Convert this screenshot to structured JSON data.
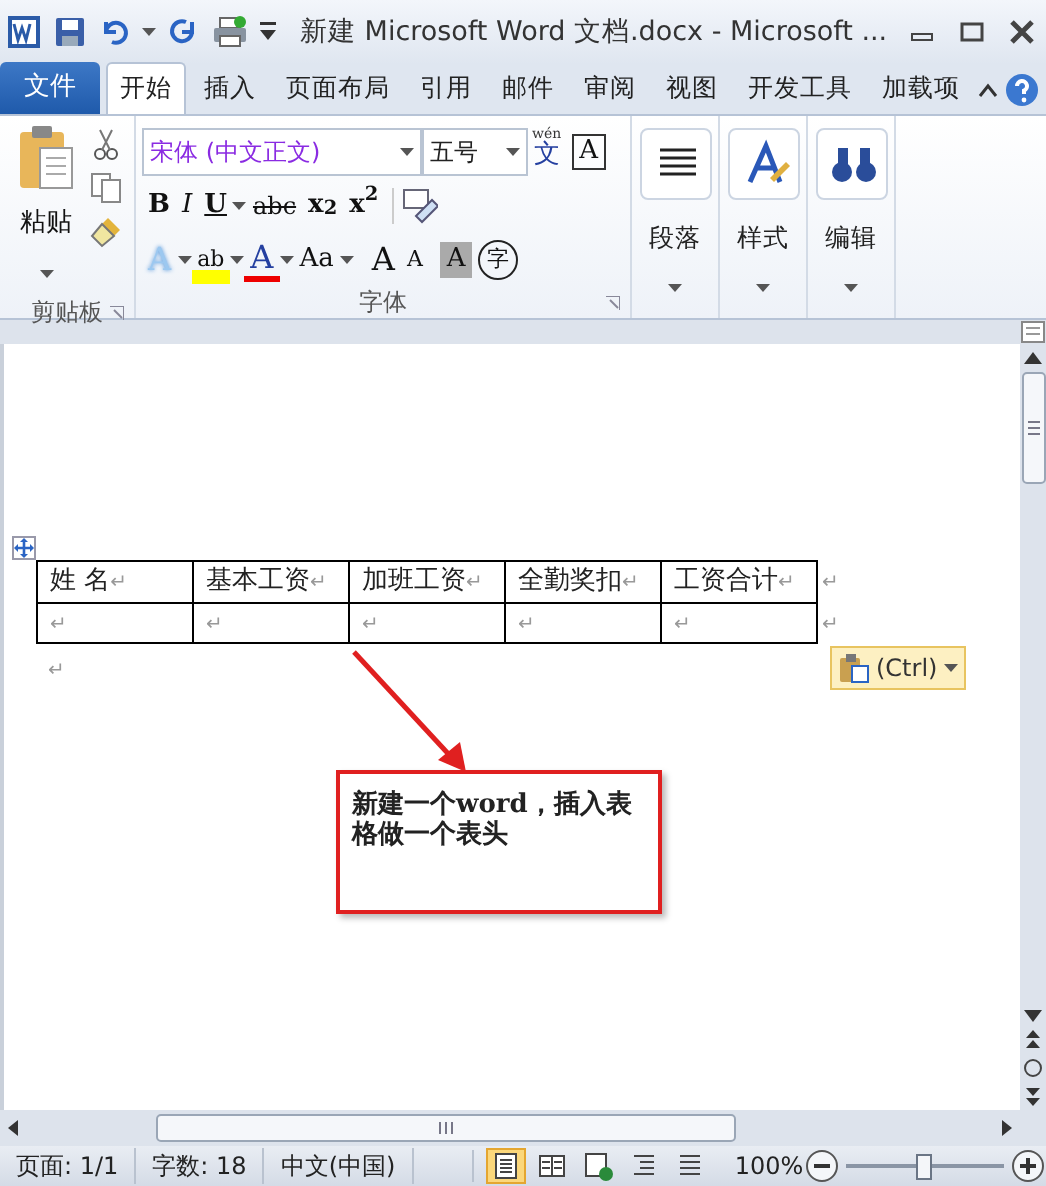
{
  "window": {
    "title": "新建 Microsoft Word 文档.docx  -  Microsoft ..."
  },
  "tabs": [
    {
      "label": "文件",
      "kind": "file",
      "selected": false
    },
    {
      "label": "开始",
      "kind": "tab",
      "selected": true
    },
    {
      "label": "插入",
      "kind": "tab",
      "selected": false
    },
    {
      "label": "页面布局",
      "kind": "tab",
      "selected": false
    },
    {
      "label": "引用",
      "kind": "tab",
      "selected": false
    },
    {
      "label": "邮件",
      "kind": "tab",
      "selected": false
    },
    {
      "label": "审阅",
      "kind": "tab",
      "selected": false
    },
    {
      "label": "视图",
      "kind": "tab",
      "selected": false
    },
    {
      "label": "开发工具",
      "kind": "tab",
      "selected": false
    },
    {
      "label": "加载项",
      "kind": "tab",
      "selected": false
    }
  ],
  "clipboard": {
    "paste_label": "粘贴",
    "group_label": "剪贴板"
  },
  "font": {
    "font_name": "宋体 (中文正文)",
    "font_size": "五号",
    "group_label": "字体",
    "top_tools": [
      {
        "kind": "phonetic",
        "top": "wén",
        "label": "文"
      },
      {
        "kind": "border",
        "label": "A"
      }
    ],
    "format_buttons": [
      {
        "kind": "bold",
        "label": "B"
      },
      {
        "kind": "italic",
        "label": "I"
      },
      {
        "kind": "underline",
        "label": "U"
      },
      {
        "kind": "strike",
        "label": "abc"
      },
      {
        "kind": "sub",
        "label": "x$_{2}$"
      },
      {
        "kind": "sup",
        "label": "x$^{2}$"
      }
    ],
    "effect_buttons": [
      {
        "kind": "effect",
        "label": "A"
      },
      {
        "kind": "highlight",
        "label": "ab"
      },
      {
        "kind": "color",
        "label": "A"
      },
      {
        "kind": "case",
        "label": "Aa"
      },
      {
        "kind": "grow",
        "label": "A"
      },
      {
        "kind": "shrink",
        "label": "A"
      },
      {
        "kind": "shade",
        "label": "A"
      },
      {
        "kind": "enclose",
        "label": "字"
      }
    ]
  },
  "big_groups": [
    {
      "kind": "paragraph",
      "label": "段落"
    },
    {
      "kind": "styles",
      "label": "样式"
    },
    {
      "kind": "editing",
      "label": "编辑"
    }
  ],
  "document": {
    "table": {
      "rows": [
        [
          {
            "text": "姓 名",
            "mark": "↵"
          },
          {
            "text": "基本工资",
            "mark": "↵"
          },
          {
            "text": "加班工资",
            "mark": "↵"
          },
          {
            "text": "全勤奖扣",
            "mark": "↵"
          },
          {
            "text": "工资合计",
            "mark": "↵"
          }
        ],
        [
          {
            "mark": "↵"
          },
          {
            "mark": "↵"
          },
          {
            "mark": "↵"
          },
          {
            "mark": "↵"
          },
          {
            "mark": "↵"
          }
        ]
      ],
      "row_marks": [
        "↵",
        "↵"
      ]
    },
    "after_mark": "↵",
    "paste_options": "(Ctrl)",
    "callout": "新建一个word，插入表格做一个表头"
  },
  "status_bar": {
    "page": "页面: 1/1",
    "words": "字数: 18",
    "language": "中文(中国)",
    "views": [
      {
        "selected": true
      },
      {
        "selected": false
      },
      {
        "selected": false
      },
      {
        "selected": false
      },
      {
        "selected": false
      }
    ],
    "zoom": "100%",
    "zoom_slider": {
      "level": 0.5
    }
  }
}
